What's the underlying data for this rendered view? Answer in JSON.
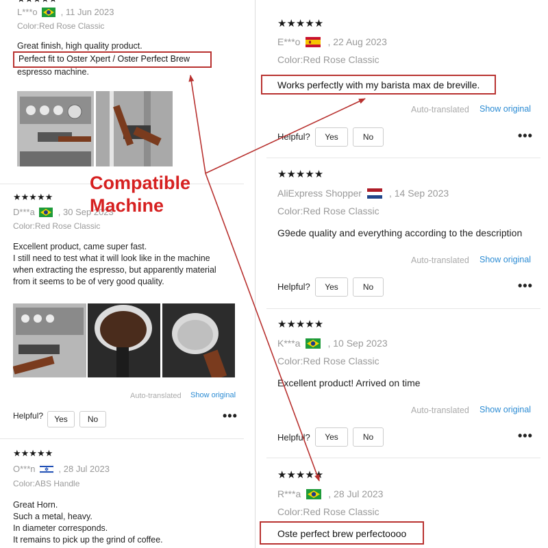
{
  "callout": {
    "line1": "Compatible",
    "line2": "Machine"
  },
  "left_reviews": [
    {
      "stars": "★★★★★",
      "author": "L***o",
      "flag": "brazil-flag",
      "date": ", 11 Jun 2023",
      "color": "Color:Red Rose Classic",
      "text_line1": "Great finish, high quality product.",
      "boxed_text": "Perfect fit to Oster Xpert / Oster Perfect Brew",
      "text_line3": "espresso machine."
    },
    {
      "stars": "★★★★★",
      "author": "D***a",
      "flag": "brazil-flag",
      "date": ", 30 Sep 2023",
      "color": "Color:Red Rose Classic",
      "lines": [
        "Excellent product, came super fast.",
        "I still need to test what it will look like in the machine",
        "when extracting the espresso, but apparently material",
        "from it seems to be of very good quality."
      ],
      "auto_translated": "Auto-translated",
      "show_original": "Show original",
      "helpful": "Helpful?",
      "yes": "Yes",
      "no": "No"
    },
    {
      "stars": "★★★★★",
      "author": "O***n",
      "flag": "israel-flag",
      "date": ", 28 Jul 2023",
      "color": "Color:ABS Handle",
      "lines": [
        "Great Horn.",
        "Such a metal, heavy.",
        "In diameter corresponds.",
        "It remains to pick up the grind of coffee."
      ]
    }
  ],
  "right_reviews": [
    {
      "stars": "★★★★★",
      "author": "E***o",
      "flag": "spain-flag",
      "date": ", 22 Aug 2023",
      "color": "Color:Red Rose Classic",
      "boxed_text": "Works perfectly with my barista max de breville.",
      "auto_translated": "Auto-translated",
      "show_original": "Show original",
      "helpful": "Helpful?",
      "yes": "Yes",
      "no": "No"
    },
    {
      "stars": "★★★★★",
      "author": "AliExpress Shopper",
      "flag": "netherlands-flag",
      "date": ", 14 Sep 2023",
      "color": "Color:Red Rose Classic",
      "text": "G9ede quality and everything according to the description",
      "auto_translated": "Auto-translated",
      "show_original": "Show original",
      "helpful": "Helpful?",
      "yes": "Yes",
      "no": "No"
    },
    {
      "stars": "★★★★★",
      "author": "K***a",
      "flag": "brazil-flag",
      "date": ", 10 Sep 2023",
      "color": "Color:Red Rose Classic",
      "text": "Excellent product! Arrived on time",
      "auto_translated": "Auto-translated",
      "show_original": "Show original",
      "helpful": "Helpful?",
      "yes": "Yes",
      "no": "No"
    },
    {
      "stars": "★★★★★",
      "author": "R***a",
      "flag": "brazil-flag",
      "date": ", 28 Jul 2023",
      "color": "Color:Red Rose Classic",
      "boxed_text": "Oste perfect brew perfectoooo"
    }
  ],
  "colors": {
    "annotation_red": "#b8312f",
    "callout_red": "#d62020",
    "link_blue": "#2b8bd3",
    "muted_gray": "#999999"
  }
}
